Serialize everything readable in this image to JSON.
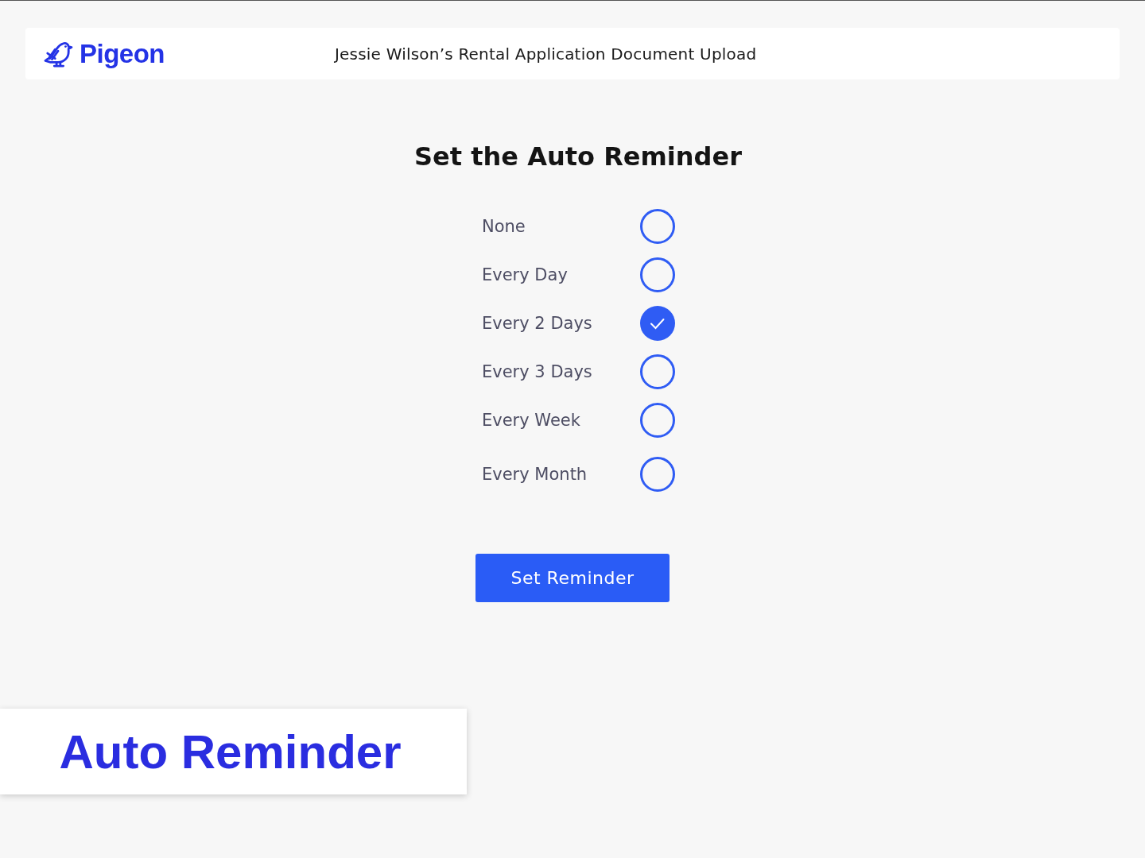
{
  "header": {
    "brand": "Pigeon",
    "title": "Jessie Wilson’s Rental Application Document Upload"
  },
  "heading": "Set the Auto Reminder",
  "options": [
    {
      "label": "None",
      "selected": false
    },
    {
      "label": "Every Day",
      "selected": false
    },
    {
      "label": "Every 2 Days",
      "selected": true
    },
    {
      "label": "Every 3 Days",
      "selected": false
    },
    {
      "label": "Every Week",
      "selected": false
    },
    {
      "label": "Every Month",
      "selected": false
    }
  ],
  "button": "Set Reminder",
  "caption": "Auto Reminder"
}
